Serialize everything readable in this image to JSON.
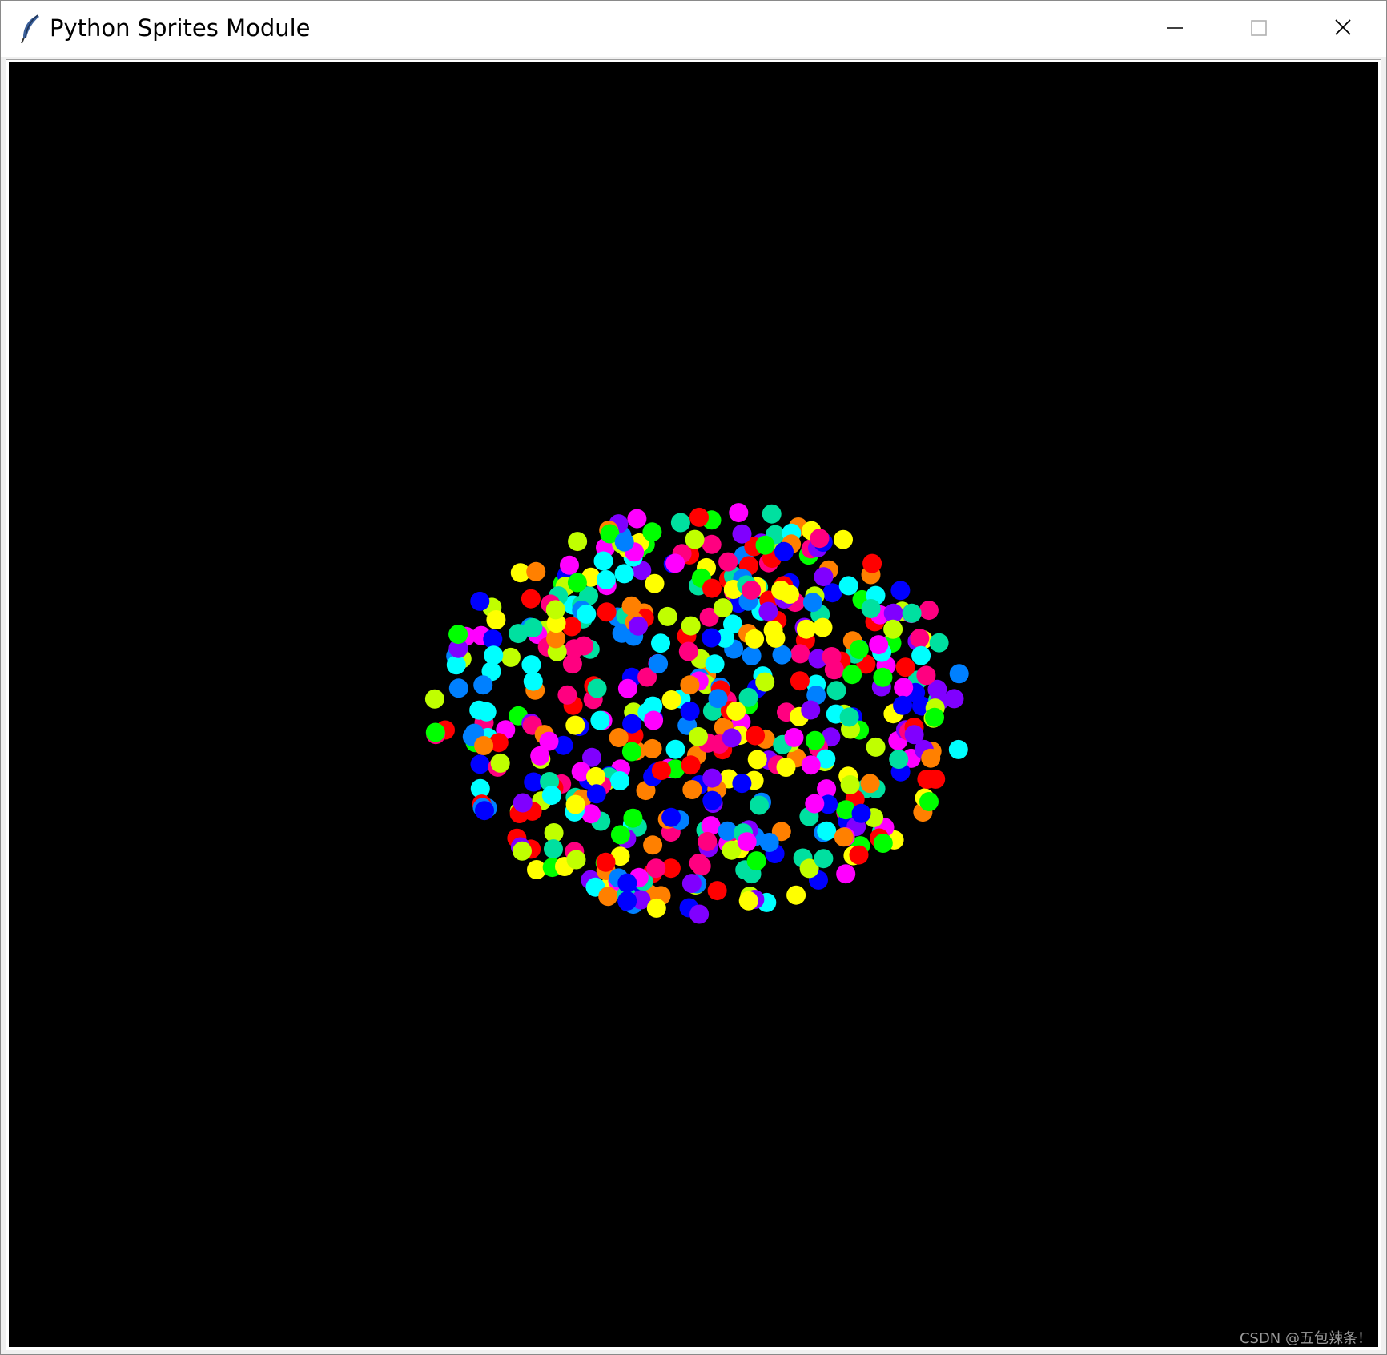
{
  "window": {
    "title": "Python Sprites Module",
    "icon": "feather-icon",
    "controls": {
      "minimize_icon": "minimize-icon",
      "maximize_icon": "maximize-icon",
      "close_icon": "close-icon"
    }
  },
  "canvas": {
    "background": "#000000",
    "sprite_palette": [
      "#ff0000",
      "#ff8000",
      "#ffff00",
      "#c0ff00",
      "#00ff00",
      "#00e0a0",
      "#00ffff",
      "#0080ff",
      "#0000ff",
      "#8000ff",
      "#ff00ff",
      "#ff0080"
    ]
  },
  "watermark": "CSDN @五包辣条！"
}
